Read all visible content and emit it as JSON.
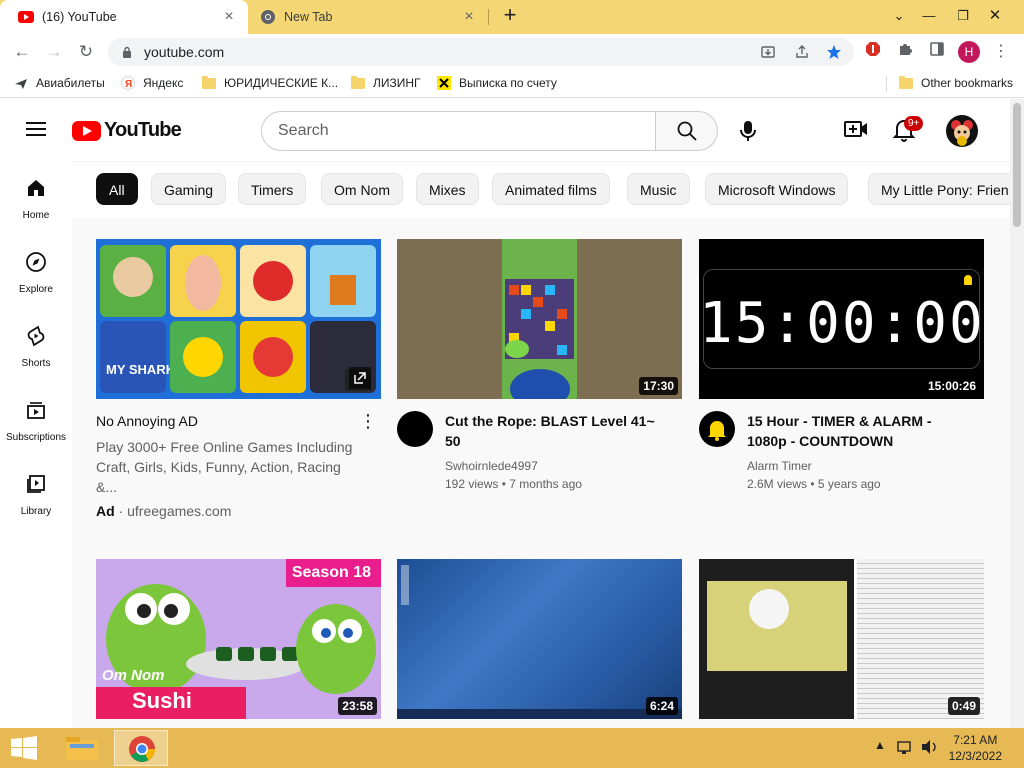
{
  "browser": {
    "tabs": [
      {
        "title": "(16) YouTube",
        "active": true
      },
      {
        "title": "New Tab",
        "active": false
      }
    ],
    "new_tab_label": "+",
    "url": "youtube.com",
    "bookmarks": [
      {
        "label": "Авиабилеты"
      },
      {
        "label": "Яндекс"
      },
      {
        "label": "ЮРИДИЧЕСКИЕ К..."
      },
      {
        "label": "ЛИЗИНГ"
      },
      {
        "label": "Выписка по счету"
      }
    ],
    "other_bookmarks": "Other bookmarks",
    "profile_initial": "H"
  },
  "youtube": {
    "logo_text": "YouTube",
    "search_placeholder": "Search",
    "notifications_badge": "9+",
    "chips": [
      "All",
      "Gaming",
      "Timers",
      "Om Nom",
      "Mixes",
      "Animated films",
      "Music",
      "Microsoft Windows",
      "My Little Pony: Frien"
    ],
    "sidebar": [
      {
        "label": "Home"
      },
      {
        "label": "Explore"
      },
      {
        "label": "Shorts"
      },
      {
        "label": "Subscriptions"
      },
      {
        "label": "Library"
      }
    ],
    "videos": [
      {
        "title": "No Annoying AD",
        "description": "Play 3000+ Free Online Games Including Craft, Girls, Kids, Funny, Action, Racing &...",
        "ad_label": "Ad",
        "ad_domain": "ufreegames.com"
      },
      {
        "title": "Cut the Rope: BLAST Level 41~ 50",
        "channel": "Swhoirnlede4997",
        "stats": "192 views • 7 months ago",
        "duration": "17:30"
      },
      {
        "title": "15 Hour - TIMER & ALARM - 1080p - COUNTDOWN",
        "channel": "Alarm Timer",
        "stats": "2.6M views • 5 years ago",
        "duration": "15:00:26",
        "thumb_text": "15:00:00"
      },
      {
        "duration": "23:58",
        "thumb_badge": "Season 18",
        "thumb_logo": "Om Nom",
        "thumb_word": "Sushi"
      },
      {
        "duration": "6:24"
      },
      {
        "duration": "0:49"
      }
    ]
  },
  "taskbar": {
    "time": "7:21 AM",
    "date": "12/3/2022"
  },
  "colors": {
    "tabstrip": "#f4d774",
    "yt_red": "#ff0000",
    "taskbar": "#e6b954"
  }
}
